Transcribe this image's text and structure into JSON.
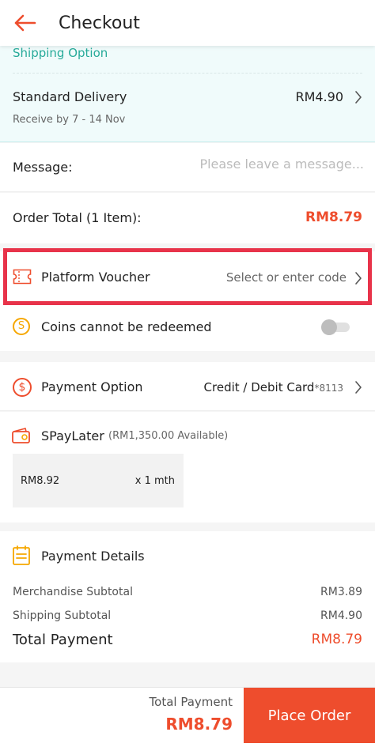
{
  "header": {
    "title": "Checkout"
  },
  "shipping": {
    "label": "Shipping Option",
    "method": "Standard Delivery",
    "price": "RM4.90",
    "eta": "Receive by 7 - 14 Nov"
  },
  "message": {
    "label": "Message:",
    "placeholder": "Please leave a message..."
  },
  "order_total": {
    "label": "Order Total (1 Item):",
    "value": "RM8.79"
  },
  "voucher": {
    "label": "Platform Voucher",
    "placeholder": "Select or enter code"
  },
  "coins": {
    "label": "Coins cannot be redeemed",
    "enabled": false
  },
  "payment_option": {
    "label": "Payment Option",
    "value": "Credit / Debit Card",
    "card_suffix": "*8113"
  },
  "spaylater": {
    "name": "SPayLater",
    "available": "(RM1,350.00 Available)",
    "plan_amount": "RM8.92",
    "plan_term": "x 1 mth"
  },
  "payment_details": {
    "title": "Payment Details",
    "merchandise_label": "Merchandise Subtotal",
    "merchandise_value": "RM3.89",
    "shipping_label": "Shipping Subtotal",
    "shipping_value": "RM4.90",
    "total_label": "Total Payment",
    "total_value": "RM8.79"
  },
  "footer": {
    "total_label": "Total Payment",
    "total_value": "RM8.79",
    "button_label": "Place Order"
  },
  "colors": {
    "accent": "#ee4d2d",
    "teal": "#26aa99",
    "highlight": "#e8334a"
  }
}
